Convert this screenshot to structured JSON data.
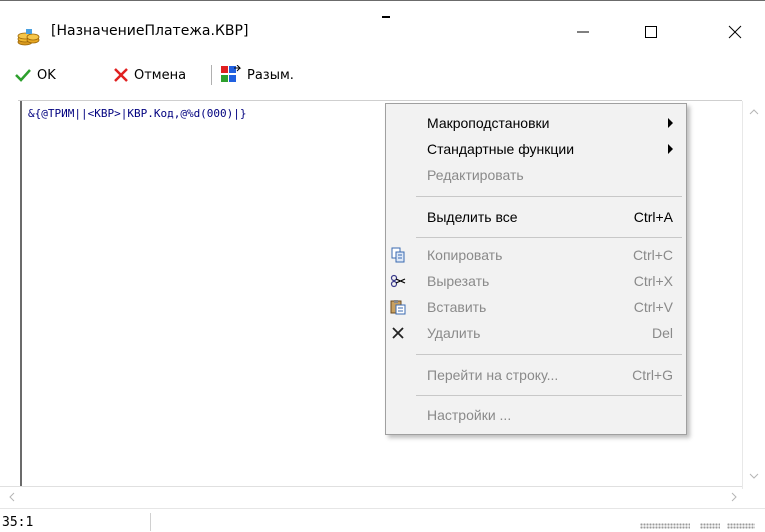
{
  "window": {
    "title": "[НазначениеПлатежа.КВР]",
    "icon": "coins-stack-icon"
  },
  "toolbar": {
    "ok_label": "OK",
    "cancel_label": "Отмена",
    "unmatch_label": "Разым."
  },
  "editor": {
    "code": "&{@ТРИМ||<КВР>|КВР.Код,@%d(000)|}"
  },
  "status": {
    "position": "35:1"
  },
  "context_menu": {
    "items": [
      {
        "label": "Макроподстановки",
        "shortcut": "",
        "submenu": true,
        "enabled": true,
        "icon": ""
      },
      {
        "label": "Стандартные функции",
        "shortcut": "",
        "submenu": true,
        "enabled": true,
        "icon": ""
      },
      {
        "label": "Редактировать",
        "shortcut": "",
        "submenu": false,
        "enabled": false,
        "icon": ""
      },
      {
        "label": "Выделить все",
        "shortcut": "Ctrl+A",
        "submenu": false,
        "enabled": true,
        "icon": ""
      },
      {
        "label": "Копировать",
        "shortcut": "Ctrl+C",
        "submenu": false,
        "enabled": false,
        "icon": "copy-icon"
      },
      {
        "label": "Вырезать",
        "shortcut": "Ctrl+X",
        "submenu": false,
        "enabled": false,
        "icon": "scissors-icon"
      },
      {
        "label": "Вставить",
        "shortcut": "Ctrl+V",
        "submenu": false,
        "enabled": false,
        "icon": "paste-icon"
      },
      {
        "label": "Удалить",
        "shortcut": "Del",
        "submenu": false,
        "enabled": false,
        "icon": "delete-x-icon"
      },
      {
        "label": "Перейти на строку...",
        "shortcut": "Ctrl+G",
        "submenu": false,
        "enabled": false,
        "icon": ""
      },
      {
        "label": "Настройки ...",
        "shortcut": "",
        "submenu": false,
        "enabled": false,
        "icon": ""
      }
    ]
  },
  "colors": {
    "ok_green": "#2ea02e",
    "cancel_red": "#e02020",
    "code_blue": "#00007f",
    "menu_bg": "#f2f2f2",
    "disabled_text": "#8a8a8a"
  }
}
